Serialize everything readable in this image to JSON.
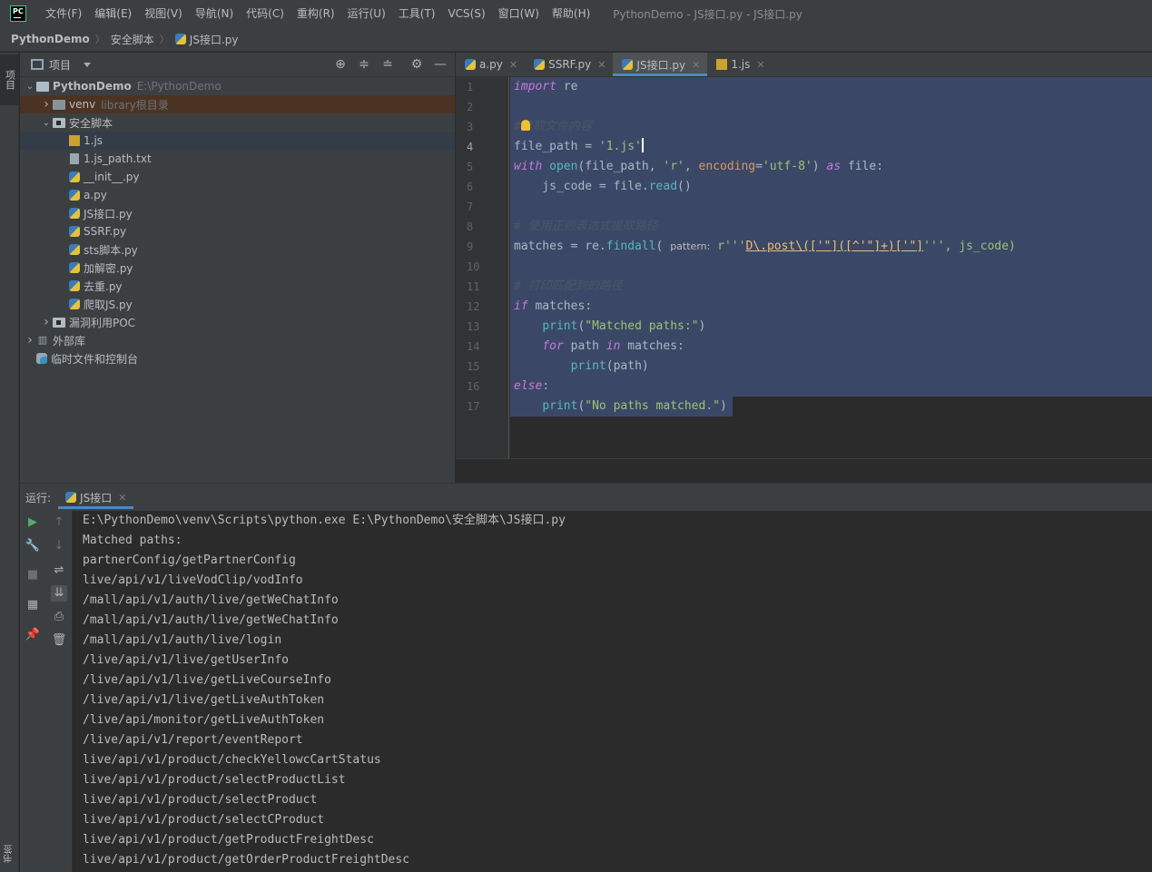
{
  "menubar": {
    "logo": "PC",
    "items": [
      "文件(F)",
      "编辑(E)",
      "视图(V)",
      "导航(N)",
      "代码(C)",
      "重构(R)",
      "运行(U)",
      "工具(T)",
      "VCS(S)",
      "窗口(W)",
      "帮助(H)"
    ],
    "window_title": "PythonDemo - JS接口.py - JS接口.py"
  },
  "breadcrumb": {
    "project": "PythonDemo",
    "folder": "安全脚本",
    "file": "JS接口.py"
  },
  "left_strip": {
    "project": "项目",
    "bookmarks": "书签"
  },
  "project_panel": {
    "title": "项目",
    "tree": [
      {
        "label": "PythonDemo",
        "hint": "E:\\PythonDemo",
        "depth": 0,
        "kind": "folder",
        "arrow": "open",
        "bold": true
      },
      {
        "label": "venv",
        "hint": "library根目录",
        "depth": 1,
        "kind": "folder-dark",
        "arrow": "closed",
        "state": "excluded"
      },
      {
        "label": "安全脚本",
        "hint": "",
        "depth": 1,
        "kind": "folder-src",
        "arrow": "open"
      },
      {
        "label": "1.js",
        "hint": "",
        "depth": 2,
        "kind": "js",
        "arrow": "",
        "state": "hover"
      },
      {
        "label": "1.js_path.txt",
        "hint": "",
        "depth": 2,
        "kind": "txt",
        "arrow": ""
      },
      {
        "label": "__init__.py",
        "hint": "",
        "depth": 2,
        "kind": "py",
        "arrow": ""
      },
      {
        "label": "a.py",
        "hint": "",
        "depth": 2,
        "kind": "py",
        "arrow": ""
      },
      {
        "label": "JS接口.py",
        "hint": "",
        "depth": 2,
        "kind": "py",
        "arrow": ""
      },
      {
        "label": "SSRF.py",
        "hint": "",
        "depth": 2,
        "kind": "py",
        "arrow": ""
      },
      {
        "label": "sts脚本.py",
        "hint": "",
        "depth": 2,
        "kind": "py",
        "arrow": ""
      },
      {
        "label": "加解密.py",
        "hint": "",
        "depth": 2,
        "kind": "py",
        "arrow": ""
      },
      {
        "label": "去重.py",
        "hint": "",
        "depth": 2,
        "kind": "py",
        "arrow": ""
      },
      {
        "label": "爬取JS.py",
        "hint": "",
        "depth": 2,
        "kind": "py",
        "arrow": ""
      },
      {
        "label": "漏洞利用POC",
        "hint": "",
        "depth": 1,
        "kind": "folder-src",
        "arrow": "closed"
      },
      {
        "label": "外部库",
        "hint": "",
        "depth": 0,
        "kind": "lib",
        "arrow": "closed"
      },
      {
        "label": "临时文件和控制台",
        "hint": "",
        "depth": 0,
        "kind": "scratch",
        "arrow": ""
      }
    ]
  },
  "editor": {
    "tabs": [
      {
        "label": "a.py",
        "kind": "py",
        "active": false
      },
      {
        "label": "SSRF.py",
        "kind": "py",
        "active": false
      },
      {
        "label": "JS接口.py",
        "kind": "py",
        "active": true
      },
      {
        "label": "1.js",
        "kind": "js",
        "active": false
      }
    ],
    "line_numbers": [
      "1",
      "2",
      "3",
      "4",
      "5",
      "6",
      "7",
      "8",
      "9",
      "10",
      "11",
      "12",
      "13",
      "14",
      "15",
      "16",
      "17"
    ],
    "code": {
      "l1_kw": "import",
      "l1_rest": " re",
      "l3_comment": "#读取文件内容",
      "l4_a": "file_path = ",
      "l4_str": "'1.js'",
      "l5_kw": "with",
      "l5_fn": "open",
      "l5_a": "(file_path, ",
      "l5_s1": "'r'",
      "l5_b": ", ",
      "l5_pm": "encoding",
      "l5_c": "=",
      "l5_s2": "'utf-8'",
      "l5_d": ") ",
      "l5_kw2": "as",
      "l5_e": " file:",
      "l6_a": "    js_code = file.",
      "l6_fn": "read",
      "l6_b": "()",
      "l8_comment": "# 使用正则表达式提取路径",
      "l9_a": "matches = re.",
      "l9_fn": "findall",
      "l9_b": "( ",
      "l9_hint": "pattern:",
      "l9_c": " r'''",
      "l9_rx": "D\\.post\\(['\"]([^'\"]+)['\"]",
      "l9_d": "''', js_code)",
      "l11_comment": "# 打印匹配到的路径",
      "l12_kw": "if",
      "l12_rest": " matches:",
      "l13_a": "    ",
      "l13_fn": "print",
      "l13_b": "(",
      "l13_str": "\"Matched paths:\"",
      "l13_c": ")",
      "l14_a": "    ",
      "l14_kw": "for",
      "l14_b": " path ",
      "l14_kw2": "in",
      "l14_c": " matches:",
      "l15_a": "        ",
      "l15_fn": "print",
      "l15_b": "(path)",
      "l16_kw": "else",
      "l16_rest": ":",
      "l17_a": "    ",
      "l17_fn": "print",
      "l17_b": "(",
      "l17_str": "\"No paths matched.\"",
      "l17_c": ")"
    }
  },
  "run_panel": {
    "label": "运行:",
    "tab": "JS接口",
    "output": [
      "E:\\PythonDemo\\venv\\Scripts\\python.exe E:\\PythonDemo\\安全脚本\\JS接口.py",
      "Matched paths:",
      "partnerConfig/getPartnerConfig",
      "live/api/v1/liveVodClip/vodInfo",
      "/mall/api/v1/auth/live/getWeChatInfo",
      "/mall/api/v1/auth/live/getWeChatInfo",
      "/mall/api/v1/auth/live/login",
      "/live/api/v1/live/getUserInfo",
      "/live/api/v1/live/getLiveCourseInfo",
      "/live/api/v1/live/getLiveAuthToken",
      "/live/api/monitor/getLiveAuthToken",
      "/live/api/v1/report/eventReport",
      "live/api/v1/product/checkYellowcCartStatus",
      "live/api/v1/product/selectProductList",
      "live/api/v1/product/selectProduct",
      "live/api/v1/product/selectCProduct",
      "live/api/v1/product/getProductFreightDesc",
      "live/api/v1/product/getOrderProductFreightDesc"
    ]
  },
  "icons": [
    "run-icon",
    "rerun-icon",
    "wrench-icon",
    "stop-icon",
    "layout-icon",
    "pin-icon",
    "up-arrow-icon",
    "down-arrow-icon",
    "soft-wrap-icon",
    "scroll-end-icon",
    "print-icon",
    "trash-icon",
    "locate-icon",
    "expand-all-icon",
    "collapse-all-icon",
    "gear-icon",
    "minimize-icon",
    "bulb-icon"
  ]
}
